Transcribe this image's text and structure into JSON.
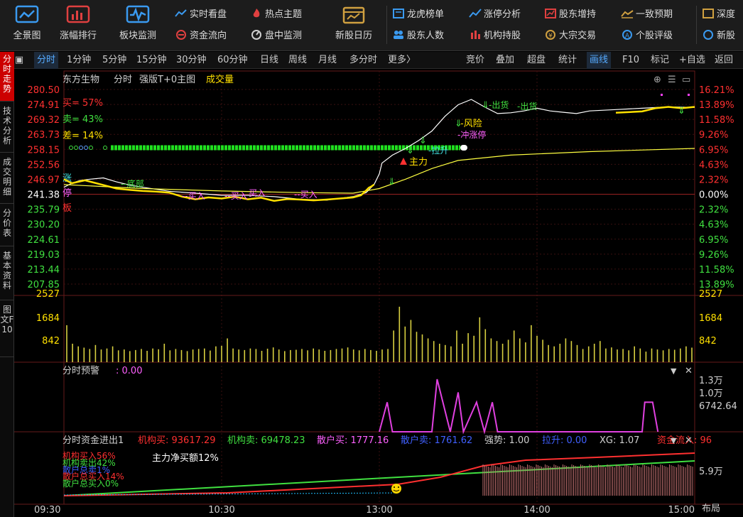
{
  "toolbar": {
    "big": [
      {
        "label": "全景图",
        "icon": "panorama-icon"
      },
      {
        "label": "涨幅排行",
        "icon": "rank-bars-icon"
      },
      {
        "label": "板块监测",
        "icon": "monitor-wave-icon"
      },
      {
        "label": "新股日历",
        "icon": "calendar-icon"
      }
    ],
    "small": [
      {
        "label": "实时看盘",
        "icon": "realtime-icon",
        "color": "#3a9af0"
      },
      {
        "label": "资金流向",
        "icon": "fund-flow-icon",
        "color": "#e04040"
      },
      {
        "label": "热点主题",
        "icon": "flame-icon",
        "color": "#e04040"
      },
      {
        "label": "盘中监测",
        "icon": "gauge-icon",
        "color": "#d0d0d0"
      },
      {
        "label": "龙虎榜单",
        "icon": "dragon-icon",
        "color": "#3a9af0"
      },
      {
        "label": "股东人数",
        "icon": "people-icon",
        "color": "#3a9af0"
      },
      {
        "label": "涨停分析",
        "icon": "limit-up-icon",
        "color": "#3a9af0"
      },
      {
        "label": "机构持股",
        "icon": "institution-icon",
        "color": "#e04040"
      },
      {
        "label": "股东增持",
        "icon": "increase-icon",
        "color": "#e04040"
      },
      {
        "label": "大宗交易",
        "icon": "block-trade-icon",
        "color": "#d0a040"
      },
      {
        "label": "一致预期",
        "icon": "consensus-icon",
        "color": "#d0a040"
      },
      {
        "label": "个股评级",
        "icon": "rating-icon",
        "color": "#3a9af0"
      },
      {
        "label": "深度",
        "icon": "depth-icon",
        "color": "#d0a040"
      },
      {
        "label": "新股",
        "icon": "new-stock-icon",
        "color": "#3a9af0"
      }
    ]
  },
  "leftnav": [
    "分时走势",
    "技术分析",
    "成交明细",
    "分价表",
    "基本资料",
    "图文F10"
  ],
  "periods": [
    "分时",
    "1分钟",
    "5分钟",
    "15分钟",
    "30分钟",
    "60分钟",
    "日线",
    "周线",
    "月线",
    "多分时",
    "更多〉"
  ],
  "right_tools": [
    "竞价",
    "叠加",
    "超盘",
    "统计",
    "画线",
    "F10",
    "标记",
    "+自选",
    "返回"
  ],
  "header": {
    "stock": "东方生物",
    "mode": "分时",
    "formula": "强版T+0主图",
    "indicator": "成交量"
  },
  "price_axis": {
    "left": [
      "280.50",
      "274.91",
      "269.32",
      "263.73",
      "258.15",
      "252.56",
      "246.97",
      "241.38",
      "235.79",
      "230.20",
      "224.61",
      "219.03",
      "213.44",
      "207.85"
    ],
    "right": [
      "16.21%",
      "13.89%",
      "11.58%",
      "9.26%",
      "6.95%",
      "4.63%",
      "2.32%",
      "0.00%",
      "2.32%",
      "4.63%",
      "6.95%",
      "9.26%",
      "11.58%",
      "13.89%"
    ]
  },
  "volume_axis": [
    "2527",
    "1684",
    "842"
  ],
  "legend_main": {
    "buy": "买= 57%",
    "sell": "卖= 43%",
    "diff": "差= 14%",
    "zhang": "涨",
    "ting": "停",
    "ban": "板"
  },
  "annotations": {
    "zhuli": "主力",
    "lasheng": "拉升",
    "fengxian": "风险",
    "chongzhangting": "冲涨停",
    "chuhuo1": "出货",
    "chuhuo2": "出货",
    "dibu": "底部",
    "mairu": "买入"
  },
  "alert_panel": {
    "title": "分时预警",
    "value": "0.00",
    "axis": [
      "1.3万",
      "1.0万",
      "6742.64"
    ]
  },
  "fund_panel": {
    "title": "分时资金进出1",
    "items": [
      {
        "label": "机构买:",
        "value": "93617.29",
        "color": "#ff3030"
      },
      {
        "label": "机构卖:",
        "value": "69478.23",
        "color": "#40e040"
      },
      {
        "label": "散户买:",
        "value": "1777.16",
        "color": "#ff60ff"
      },
      {
        "label": "散户卖:",
        "value": "1761.62",
        "color": "#4060ff"
      },
      {
        "label": "强势:",
        "value": "1.00",
        "color": "#d0d0d0"
      },
      {
        "label": "拉升:",
        "value": "0.00",
        "color": "#4060ff"
      },
      {
        "label": "XG:",
        "value": "1.07",
        "color": "#d0d0d0"
      },
      {
        "label": "资金流入:",
        "value": "96",
        "color": "#ff3030"
      }
    ],
    "net": "主力净买额12%",
    "left_labels": [
      "机构买入56%",
      "机构卖出42%",
      "散户总卖1%",
      "散户总买入14%",
      "散户总买入0%"
    ],
    "axis": "5.9万"
  },
  "time_axis": [
    "09:30",
    "10:30",
    "13:00",
    "14:00",
    "15:00"
  ],
  "bottom_right": "布局",
  "chart_data": {
    "type": "line",
    "title": "",
    "prev_close": 241.38,
    "price_range": [
      207.85,
      280.5
    ],
    "time_range_min": [
      0,
      240
    ],
    "series": [
      {
        "name": "",
        "color": "#ffffff",
        "x": [
          0,
          3,
          6,
          10,
          15,
          20,
          25,
          30,
          40,
          50,
          60,
          70,
          80,
          90,
          100,
          110,
          115,
          118,
          120,
          121,
          125,
          130,
          135,
          140,
          145,
          150,
          155,
          160,
          165,
          170,
          175,
          180,
          185,
          190,
          195,
          200,
          210,
          220,
          230,
          240
        ],
        "y": [
          244.0,
          245.5,
          246.5,
          247.0,
          247.5,
          246.0,
          244.8,
          244.0,
          242.5,
          241.8,
          241.0,
          241.0,
          240.5,
          239.5,
          239.2,
          240.5,
          242.0,
          245.0,
          249.0,
          253.0,
          256.0,
          258.5,
          261.5,
          265.0,
          270.5,
          274.8,
          276.8,
          274.0,
          271.5,
          271.8,
          272.5,
          273.5,
          272.5,
          272.0,
          271.5,
          272.5,
          273.0,
          273.5,
          274.0,
          273.8
        ]
      },
      {
        "name": "",
        "color": "#ffff40",
        "x": [
          0,
          30,
          60,
          90,
          110,
          120,
          130,
          140,
          150,
          170,
          200,
          240
        ],
        "y": [
          245.0,
          243.5,
          242.6,
          242.0,
          241.8,
          243.5,
          247.0,
          251.0,
          254.0,
          256.0,
          257.3,
          258.5
        ]
      },
      {
        "name": "",
        "color": "#ffe000",
        "x": [
          0,
          3,
          8,
          15,
          20,
          25,
          30,
          35,
          40,
          45,
          50,
          55,
          60,
          65,
          70,
          75,
          80,
          85,
          90,
          95,
          100,
          105,
          110,
          113,
          115,
          116,
          117,
          118
        ],
        "y": [
          247.0,
          245.5,
          246.6,
          244.8,
          243.5,
          243.0,
          242.6,
          242.4,
          242.0,
          240.5,
          239.5,
          240.2,
          239.8,
          240.5,
          239.5,
          240.1,
          238.9,
          239.6,
          239.4,
          239.1,
          239.4,
          239.8,
          240.2,
          241.0,
          242.8,
          243.8,
          244.3,
          245.0
        ]
      },
      {
        "name": "",
        "color": "#ffe000",
        "x": [
          210,
          220,
          225,
          230,
          235,
          240
        ],
        "y": [
          271.8,
          272.3,
          273.5,
          274.0,
          273.5,
          274.0
        ]
      }
    ],
    "volume": {
      "max": 2527,
      "values": [
        1400,
        700,
        600,
        550,
        500,
        650,
        480,
        520,
        600,
        450,
        480,
        420,
        460,
        500,
        430,
        520,
        490,
        700,
        450,
        500,
        460,
        420,
        480,
        500,
        520,
        440,
        600,
        620,
        900,
        520,
        480,
        460,
        520,
        500,
        430,
        510,
        560,
        480,
        420,
        460,
        470,
        500,
        450,
        520,
        480,
        430,
        460,
        500,
        520,
        560,
        480,
        450,
        500,
        460,
        430,
        480,
        500,
        1200,
        2100,
        1350,
        1600,
        1150,
        1050,
        900,
        800,
        700,
        650,
        600,
        1200,
        700,
        1100,
        1000,
        1700,
        1250,
        900,
        800,
        700,
        850,
        1200,
        900,
        750,
        1400,
        1000,
        850,
        650,
        600,
        700,
        900,
        800,
        650,
        500,
        600,
        700,
        800,
        520,
        560,
        480,
        500,
        450,
        600,
        520,
        400,
        520,
        480,
        450,
        500,
        470,
        520,
        600,
        550
      ]
    },
    "alert": {
      "x": [
        120,
        123,
        125,
        140,
        142,
        147,
        150,
        152,
        157,
        160,
        163,
        165,
        220,
        221,
        224,
        226
      ],
      "y": [
        0,
        9000,
        0,
        0,
        16000,
        0,
        12000,
        0,
        9000,
        0,
        9000,
        0,
        0,
        9000,
        9000,
        0
      ]
    }
  }
}
